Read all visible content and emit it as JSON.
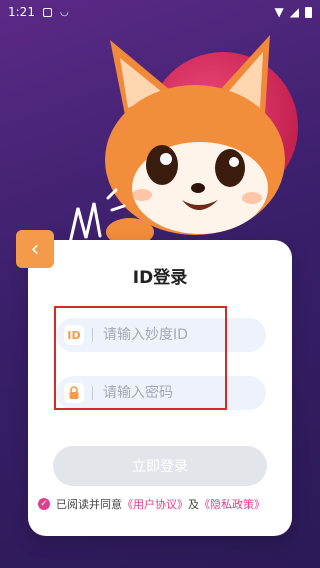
{
  "status_bar": {
    "time": "1:21"
  },
  "title": "ID登录",
  "id_field": {
    "icon_text": "ID",
    "placeholder": "请输入妙度ID"
  },
  "password_field": {
    "placeholder": "请输入密码"
  },
  "login_button": {
    "label": "立即登录"
  },
  "agreement": {
    "prefix": "已阅读并同意",
    "user_agreement": "《用户协议》",
    "and": "及",
    "privacy_policy": "《隐私政策》"
  },
  "colors": {
    "accent_orange": "#f39a4b",
    "link_pink": "#e23d8c",
    "background_purple": "#3a1f6b"
  }
}
